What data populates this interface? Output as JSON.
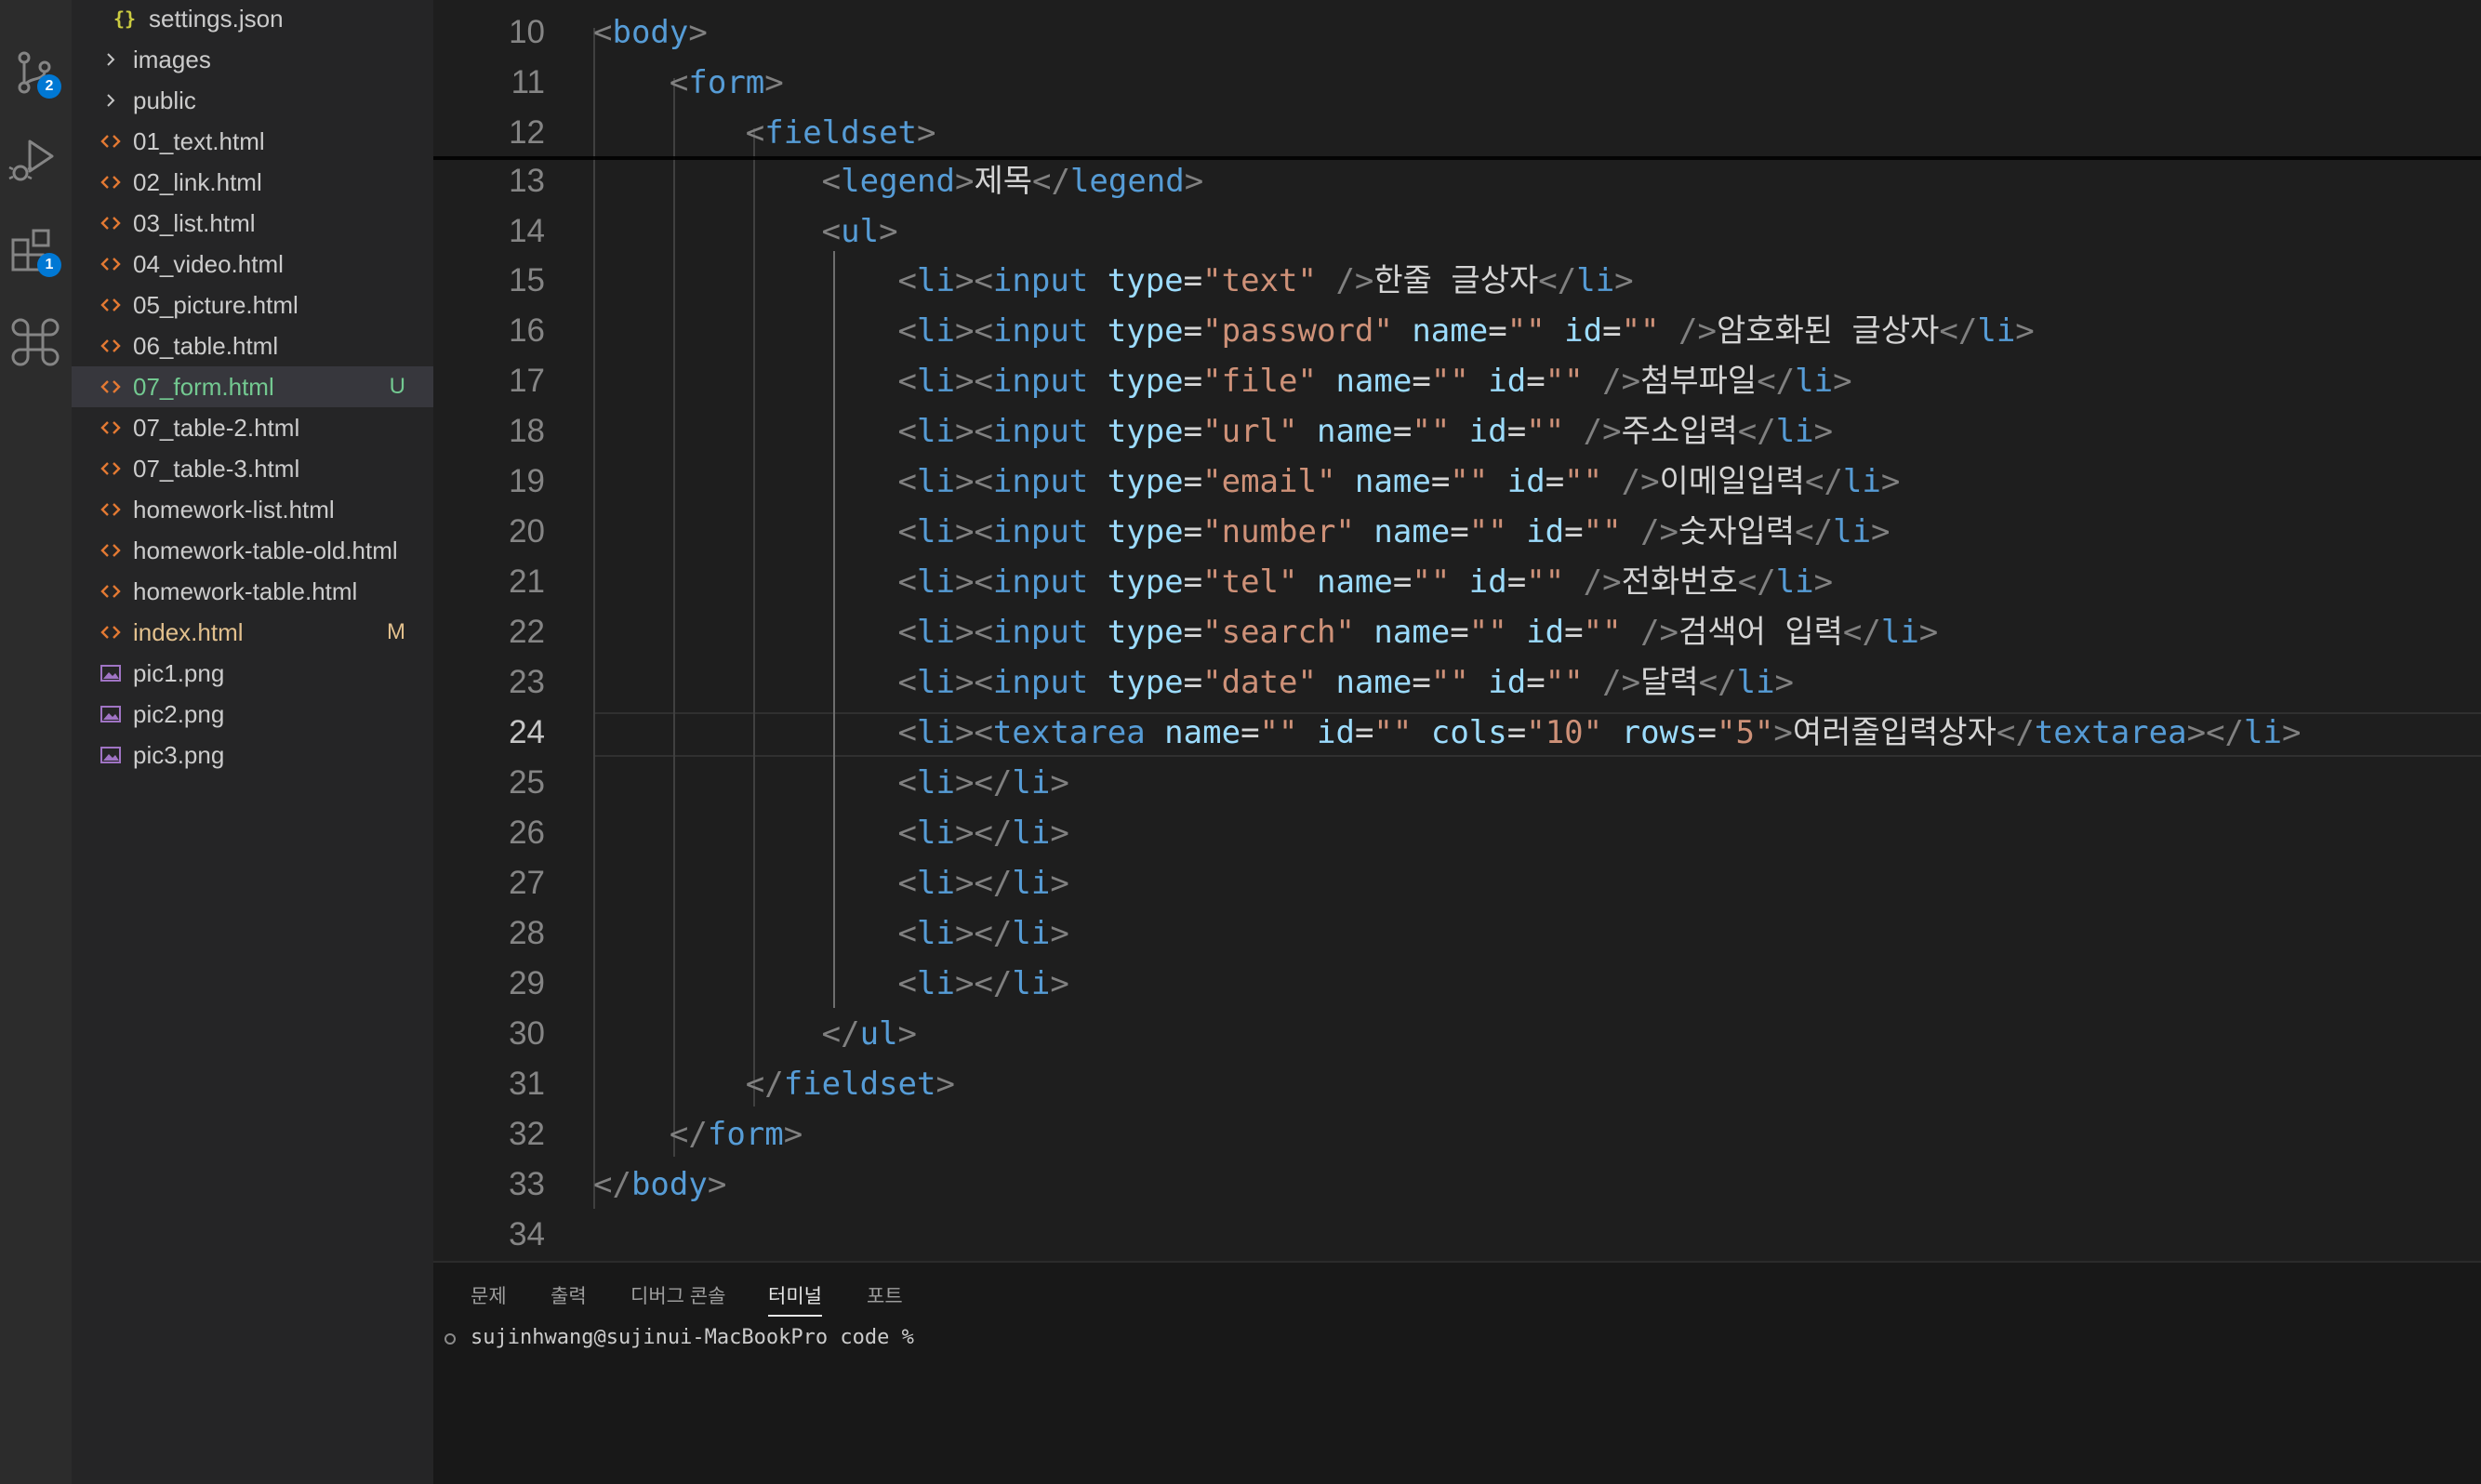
{
  "activity_bar": {
    "source_control_badge": "2",
    "extensions_badge": "1"
  },
  "explorer": {
    "files": [
      {
        "name": "settings.json",
        "kind": "json-icon"
      },
      {
        "name": "images",
        "kind": "folder-collapsed"
      },
      {
        "name": "public",
        "kind": "folder-collapsed"
      },
      {
        "name": "01_text.html",
        "kind": "html-icon"
      },
      {
        "name": "02_link.html",
        "kind": "html-icon"
      },
      {
        "name": "03_list.html",
        "kind": "html-icon"
      },
      {
        "name": "04_video.html",
        "kind": "html-icon"
      },
      {
        "name": "05_picture.html",
        "kind": "html-icon"
      },
      {
        "name": "06_table.html",
        "kind": "html-icon"
      },
      {
        "name": "07_form.html",
        "kind": "html-icon",
        "status": "U",
        "selected": true
      },
      {
        "name": "07_table-2.html",
        "kind": "html-icon"
      },
      {
        "name": "07_table-3.html",
        "kind": "html-icon"
      },
      {
        "name": "homework-list.html",
        "kind": "html-icon"
      },
      {
        "name": "homework-table-old.html",
        "kind": "html-icon"
      },
      {
        "name": "homework-table.html",
        "kind": "html-icon"
      },
      {
        "name": "index.html",
        "kind": "html-icon",
        "status": "M"
      },
      {
        "name": "pic1.png",
        "kind": "image-icon"
      },
      {
        "name": "pic2.png",
        "kind": "image-icon"
      },
      {
        "name": "pic3.png",
        "kind": "image-icon"
      }
    ]
  },
  "editor": {
    "active_line": "24",
    "lines": [
      {
        "n": "10",
        "code": "<body>"
      },
      {
        "n": "11",
        "code": "    <form>"
      },
      {
        "n": "12",
        "code": "        <fieldset>"
      },
      {
        "n": "13",
        "code": "            <legend>제목</legend>"
      },
      {
        "n": "14",
        "code": "            <ul>"
      },
      {
        "n": "15",
        "code": "                <li><input type=\"text\" />한줄 글상자</li>"
      },
      {
        "n": "16",
        "code": "                <li><input type=\"password\" name=\"\" id=\"\" />암호화된 글상자</li>"
      },
      {
        "n": "17",
        "code": "                <li><input type=\"file\" name=\"\" id=\"\" />첨부파일</li>"
      },
      {
        "n": "18",
        "code": "                <li><input type=\"url\" name=\"\" id=\"\" />주소입력</li>"
      },
      {
        "n": "19",
        "code": "                <li><input type=\"email\" name=\"\" id=\"\" />이메일입력</li>"
      },
      {
        "n": "20",
        "code": "                <li><input type=\"number\" name=\"\" id=\"\" />숫자입력</li>"
      },
      {
        "n": "21",
        "code": "                <li><input type=\"tel\" name=\"\" id=\"\" />전화번호</li>"
      },
      {
        "n": "22",
        "code": "                <li><input type=\"search\" name=\"\" id=\"\" />검색어 입력</li>"
      },
      {
        "n": "23",
        "code": "                <li><input type=\"date\" name=\"\" id=\"\" />달력</li>"
      },
      {
        "n": "24",
        "code": "                <li><textarea name=\"\" id=\"\" cols=\"10\" rows=\"5\">여러줄입력상자</textarea></li>"
      },
      {
        "n": "25",
        "code": "                <li></li>"
      },
      {
        "n": "26",
        "code": "                <li></li>"
      },
      {
        "n": "27",
        "code": "                <li></li>"
      },
      {
        "n": "28",
        "code": "                <li></li>"
      },
      {
        "n": "29",
        "code": "                <li></li>"
      },
      {
        "n": "30",
        "code": "            </ul>"
      },
      {
        "n": "31",
        "code": "        </fieldset>"
      },
      {
        "n": "32",
        "code": "    </form>"
      },
      {
        "n": "33",
        "code": "</body>"
      },
      {
        "n": "34",
        "code": ""
      }
    ]
  },
  "panel": {
    "tabs": [
      {
        "label": "문제"
      },
      {
        "label": "출력"
      },
      {
        "label": "디버그 콘솔"
      },
      {
        "label": "터미널",
        "active": true
      },
      {
        "label": "포트"
      }
    ],
    "terminal_prompt": "sujinhwang@sujinui-MacBookPro code %"
  },
  "colors": {
    "tag": "#569cd6",
    "attribute": "#9cdcfe",
    "string": "#ce9178",
    "bracket": "#808080",
    "text": "#d4d4d4",
    "untracked": "#73c991",
    "modified": "#e2c08d",
    "badge": "#0078d4"
  }
}
